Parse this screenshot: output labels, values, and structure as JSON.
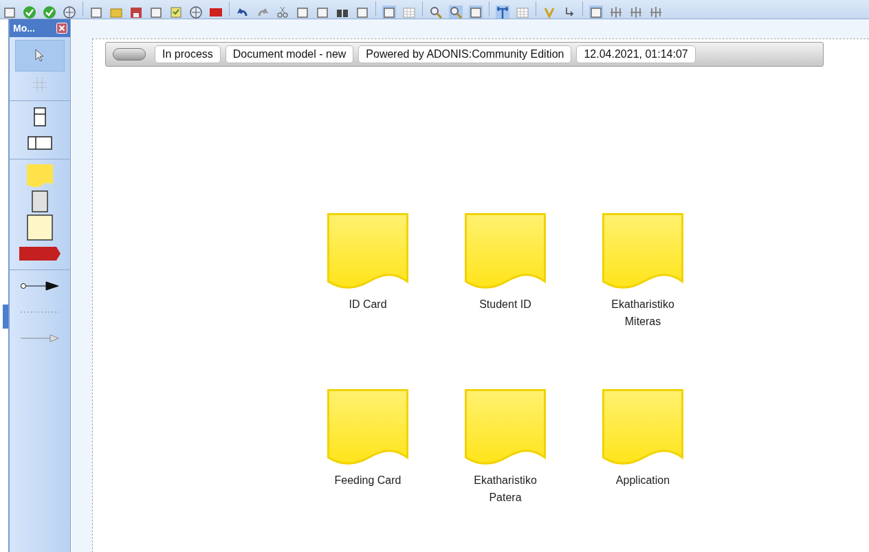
{
  "palette": {
    "title": "Mo...",
    "groups": [
      {
        "tools": [
          {
            "kind": "pointer",
            "selected": true
          },
          {
            "kind": "grid",
            "selected": false
          }
        ]
      },
      {
        "tools": [
          {
            "kind": "lane-horizontal",
            "selected": false
          },
          {
            "kind": "lane-vertical",
            "selected": false
          }
        ]
      },
      {
        "tools": [
          {
            "kind": "document",
            "selected": false
          },
          {
            "kind": "grey-box",
            "selected": false
          },
          {
            "kind": "note",
            "selected": false
          },
          {
            "kind": "red-arrow",
            "selected": false
          }
        ]
      },
      {
        "tools": [
          {
            "kind": "connector",
            "selected": false
          },
          {
            "kind": "dotted",
            "selected": false
          },
          {
            "kind": "arrow",
            "selected": false
          }
        ]
      }
    ]
  },
  "status_bar": {
    "fields": [
      "In process",
      "Document model - new",
      "Powered by ADONIS:Community Edition",
      "12.04.2021, 01:14:07"
    ]
  },
  "documents": [
    {
      "label": "ID Card"
    },
    {
      "label": "Student ID"
    },
    {
      "label": "Ekatharistiko Miteras"
    },
    {
      "label": "Feeding Card"
    },
    {
      "label": "Ekatharistiko Patera"
    },
    {
      "label": "Application"
    }
  ]
}
